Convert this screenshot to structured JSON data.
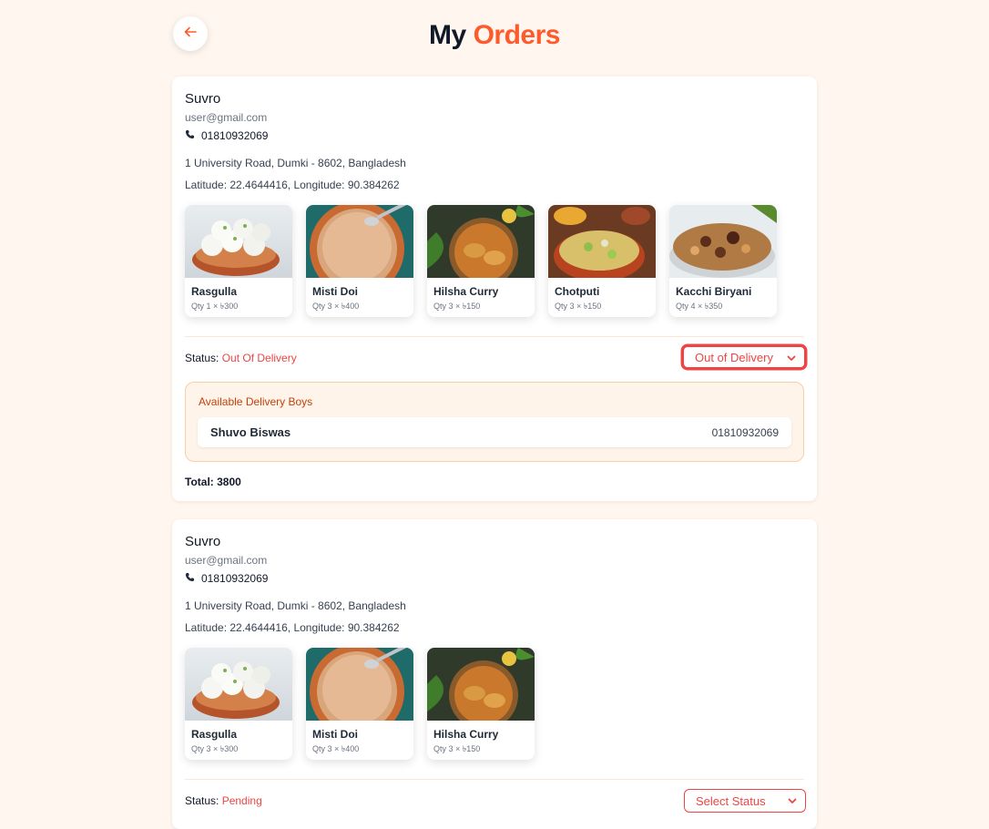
{
  "header": {
    "title_main": "My",
    "title_accent": "Orders",
    "back_icon": "arrow-left-icon"
  },
  "colors": {
    "accent": "#ff5a2c",
    "status_red": "#ef4444",
    "background": "#fff7ef"
  },
  "orders": [
    {
      "customer_name": "Suvro",
      "email": "user@gmail.com",
      "phone": "01810932069",
      "address": "1 University Road, Dumki - 8602, Bangladesh",
      "geo": "Latitude: 22.4644416, Longitude: 90.384262",
      "items": [
        {
          "name": "Rasgulla",
          "qty": "Qty 1 × ৳300"
        },
        {
          "name": "Misti Doi",
          "qty": "Qty 3 × ৳400"
        },
        {
          "name": "Hilsha Curry",
          "qty": "Qty 3 × ৳150"
        },
        {
          "name": "Chotputi",
          "qty": "Qty 3 × ৳150"
        },
        {
          "name": "Kacchi Biryani",
          "qty": "Qty 4 × ৳350"
        }
      ],
      "status_label": "Status:",
      "status_value": "Out Of Delivery",
      "select_value": "Out of Delivery",
      "delivery": {
        "title": "Available Delivery Boys",
        "boys": [
          {
            "name": "Shuvo Biswas",
            "phone": "01810932069"
          }
        ]
      },
      "total": "Total: 3800"
    },
    {
      "customer_name": "Suvro",
      "email": "user@gmail.com",
      "phone": "01810932069",
      "address": "1 University Road, Dumki - 8602, Bangladesh",
      "geo": "Latitude: 22.4644416, Longitude: 90.384262",
      "items": [
        {
          "name": "Rasgulla",
          "qty": "Qty 3 × ৳300"
        },
        {
          "name": "Misti Doi",
          "qty": "Qty 3 × ৳400"
        },
        {
          "name": "Hilsha Curry",
          "qty": "Qty 3 × ৳150"
        }
      ],
      "status_label": "Status:",
      "status_value": "Pending",
      "select_value": "Select Status"
    }
  ]
}
